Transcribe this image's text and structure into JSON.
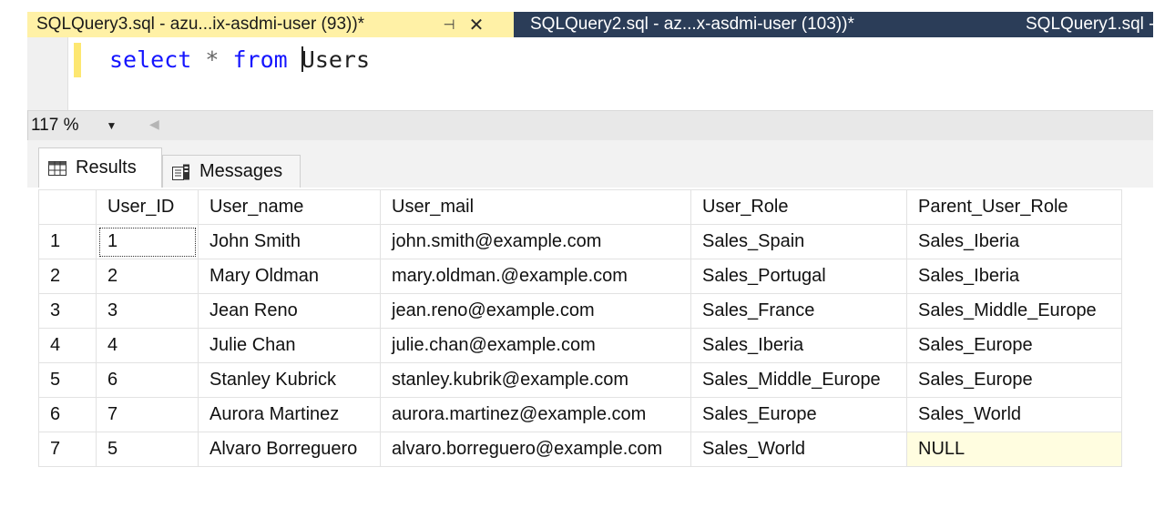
{
  "tabs": {
    "active": "SQLQuery3.sql - azu...ix-asdmi-user (93))*",
    "second": "SQLQuery2.sql - az...x-asdmi-user (103))*",
    "third": "SQLQuery1.sql -",
    "pin_glyph": "⊣",
    "close_glyph": "✕"
  },
  "editor": {
    "keyword_select": "select",
    "operator_star": "*",
    "keyword_from": "from",
    "identifier": "Users"
  },
  "zoom": {
    "value": "117 %"
  },
  "result_tabs": {
    "results": "Results",
    "messages": "Messages"
  },
  "grid": {
    "columns": [
      "User_ID",
      "User_name",
      "User_mail",
      "User_Role",
      "Parent_User_Role"
    ],
    "rows": [
      [
        "1",
        "1",
        "John Smith",
        "john.smith@example.com",
        "Sales_Spain",
        "Sales_Iberia"
      ],
      [
        "2",
        "2",
        "Mary Oldman",
        "mary.oldman.@example.com",
        "Sales_Portugal",
        "Sales_Iberia"
      ],
      [
        "3",
        "3",
        "Jean Reno",
        "jean.reno@example.com",
        "Sales_France",
        "Sales_Middle_Europe"
      ],
      [
        "4",
        "4",
        "Julie Chan",
        "julie.chan@example.com",
        "Sales_Iberia",
        "Sales_Europe"
      ],
      [
        "5",
        "6",
        "Stanley Kubrick",
        "stanley.kubrik@example.com",
        "Sales_Middle_Europe",
        "Sales_Europe"
      ],
      [
        "6",
        "7",
        "Aurora Martinez",
        "aurora.martinez@example.com",
        "Sales_Europe",
        "Sales_World"
      ],
      [
        "7",
        "5",
        "Alvaro Borreguero",
        "alvaro.borreguero@example.com",
        "Sales_World",
        "NULL"
      ]
    ]
  },
  "colors": {
    "active_tab": "#fff1a6",
    "inactive_tab": "#2b3d58",
    "keyword": "#1515ff",
    "null_cell": "#fffde0"
  }
}
